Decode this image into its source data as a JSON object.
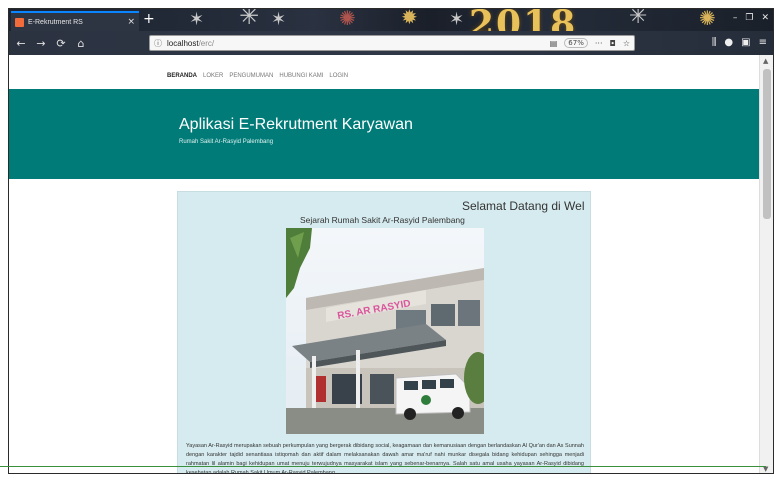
{
  "browser": {
    "tab_title": "E-Rekrutment RS",
    "new_tab": "+",
    "tab_close": "×",
    "theme_year": "2018",
    "url_host": "localhost",
    "url_path": "/erc/",
    "zoom": "67%",
    "back": "←",
    "forward": "→",
    "reload": "⟳",
    "home": "⌂",
    "info": "ⓘ",
    "menu_dots": "···",
    "window_controls": [
      "–",
      "❐",
      "✕"
    ]
  },
  "site": {
    "nav": [
      "BERANDA",
      "LOKER",
      "PENGUMUMAN",
      "HUBUNGI KAMI",
      "LOGIN"
    ],
    "title": "Aplikasi E-Rekrutment Karyawan",
    "subtitle": "Rumah Sakit Ar-Rasyid Palembang"
  },
  "content": {
    "welcome": "Selamat Datang di Wel",
    "history_title": "Sejarah Rumah Sakit Ar-Rasyid Palembang",
    "building_sign": "RS. AR RASYID",
    "paragraph": "Yayasan Ar-Rasyid merupakan sebuah perkumpulan yang bergerak dibidang social, keagamaan dan kemanusiaan dengan berlandaskan Al Qur'an dan As Sunnah dengan karakter tajdid senantiasa istiqomah dan aktif dalam melaksanakan dawah amar ma'ruf nahi munkar disegala bidang kehidupan sehingga menjadi rahmatan lil alamin bagi kehidupan umat menuju terwujudnya masyarakat islam yang sebenar-benarnya. Salah satu amal usaha yayasan Ar-Rasyid dibidang kesehatan adalah Rumah Sakit Umum Ar-Rasyid Palembang."
  },
  "colors": {
    "hero_bg": "#007b78",
    "card_bg": "#d6ebef"
  }
}
